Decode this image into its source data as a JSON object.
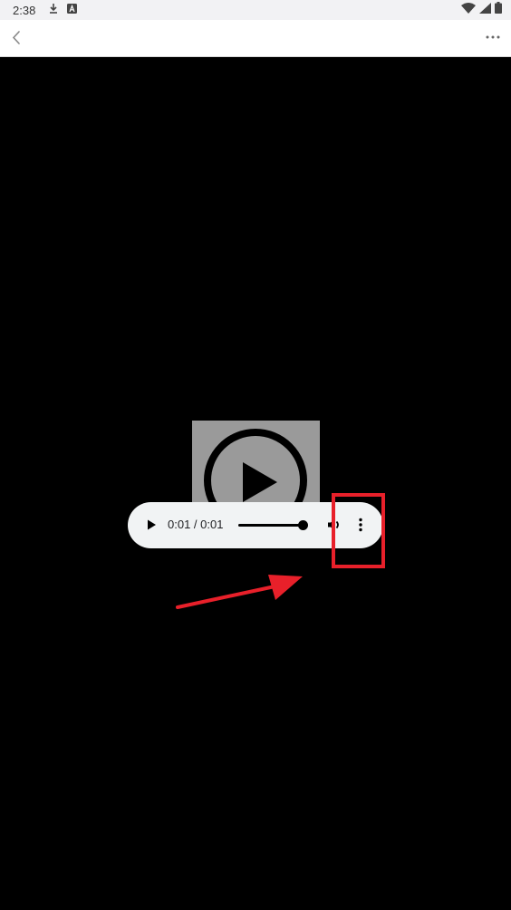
{
  "status_bar": {
    "time": "2:38",
    "left_icons": [
      "download-icon",
      "a-letter-icon"
    ],
    "right_icons": [
      "wifi-icon",
      "cell-signal-icon",
      "battery-icon"
    ]
  },
  "app_bar": {
    "back_icon": "back-chevron-icon",
    "more_icon": "more-horizontal-icon"
  },
  "audio_player": {
    "current_time": "0:01",
    "duration": "0:01",
    "time_display": "0:01 / 0:01",
    "progress": 1.0,
    "icons": [
      "play-icon",
      "volume-icon",
      "more-vertical-icon"
    ]
  },
  "colors": {
    "background": "#000000",
    "player_bg": "#f1f3f4",
    "annotation": "#e8202a",
    "status_bg": "#f2f2f4"
  }
}
